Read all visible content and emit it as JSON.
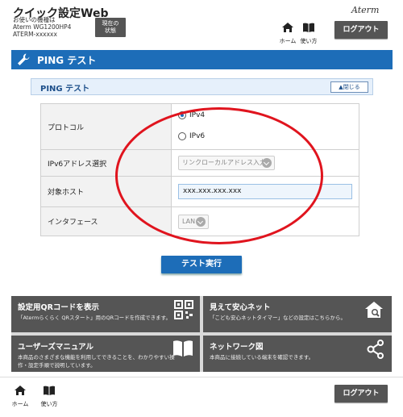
{
  "header": {
    "app_title": "クイック設定Web",
    "model_label": "お使いの機種は",
    "model_name": "Aterm WG1200HP4",
    "model_id": "ATERM-xxxxxx",
    "status_button": "現在の\n状態",
    "home_label": "ホーム",
    "help_label": "使い方",
    "brand": "Aterm",
    "logout_label": "ログアウト"
  },
  "page": {
    "title": "PING テスト"
  },
  "panel": {
    "title": "PING テスト",
    "collapse_label": "閉じる"
  },
  "form": {
    "protocol_label": "プロトコル",
    "protocol_options": [
      "IPv4",
      "IPv6"
    ],
    "protocol_selected": "IPv4",
    "ipv6_address_label": "IPv6アドレス選択",
    "ipv6_address_value": "リンクローカルアドレス入力",
    "target_host_label": "対象ホスト",
    "target_host_value": "xxx.xxx.xxx.xxx",
    "interface_label": "インタフェース",
    "interface_value": "LAN"
  },
  "run_button": "テスト実行",
  "tiles": [
    {
      "title": "設定用QRコードを表示",
      "desc": "「Atermらくらく QRスタート」用のQRコードを作成できます。"
    },
    {
      "title": "見えて安心ネット",
      "desc": "「こども安心ネットタイマー」などの設定はこちらから。"
    },
    {
      "title": "ユーザーズマニュアル",
      "desc": "本商品のさまざまな機能を利用してできることを、わかりやすい操作・設定手順で説明しています。"
    },
    {
      "title": "ネットワーク図",
      "desc": "本商品に接続している端末を確認できます。"
    }
  ],
  "footer": {
    "home_label": "ホーム",
    "help_label": "使い方",
    "logout_label": "ログアウト"
  },
  "colors": {
    "accent": "#1d6db8",
    "annotation": "#e0141e",
    "dark_button": "#555555"
  }
}
